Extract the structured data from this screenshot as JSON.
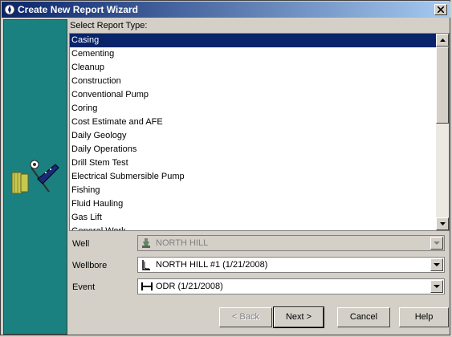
{
  "window": {
    "title": "Create New Report Wizard"
  },
  "report_list": {
    "label": "Select Report Type:",
    "items": [
      "Casing",
      "Cementing",
      "Cleanup",
      "Construction",
      "Conventional Pump",
      "Coring",
      "Cost Estimate and AFE",
      "Daily Geology",
      "Daily Operations",
      "Drill Stem Test",
      "Electrical Submersible Pump",
      "Fishing",
      "Fluid Hauling",
      "Gas Lift",
      "General Work"
    ],
    "selected_index": 0
  },
  "fields": {
    "well": {
      "label": "Well",
      "value": "NORTH HILL"
    },
    "wellbore": {
      "label": "Wellbore",
      "value": "NORTH HILL #1 (1/21/2008)"
    },
    "event": {
      "label": "Event",
      "value": "ODR (1/21/2008)"
    }
  },
  "buttons": {
    "back": "< Back",
    "next": "Next >",
    "cancel": "Cancel",
    "help": "Help"
  },
  "colors": {
    "titlebar_start": "#0a246a",
    "titlebar_end": "#a6caf0",
    "sidebar": "#1a8080",
    "selection": "#0a246a"
  }
}
